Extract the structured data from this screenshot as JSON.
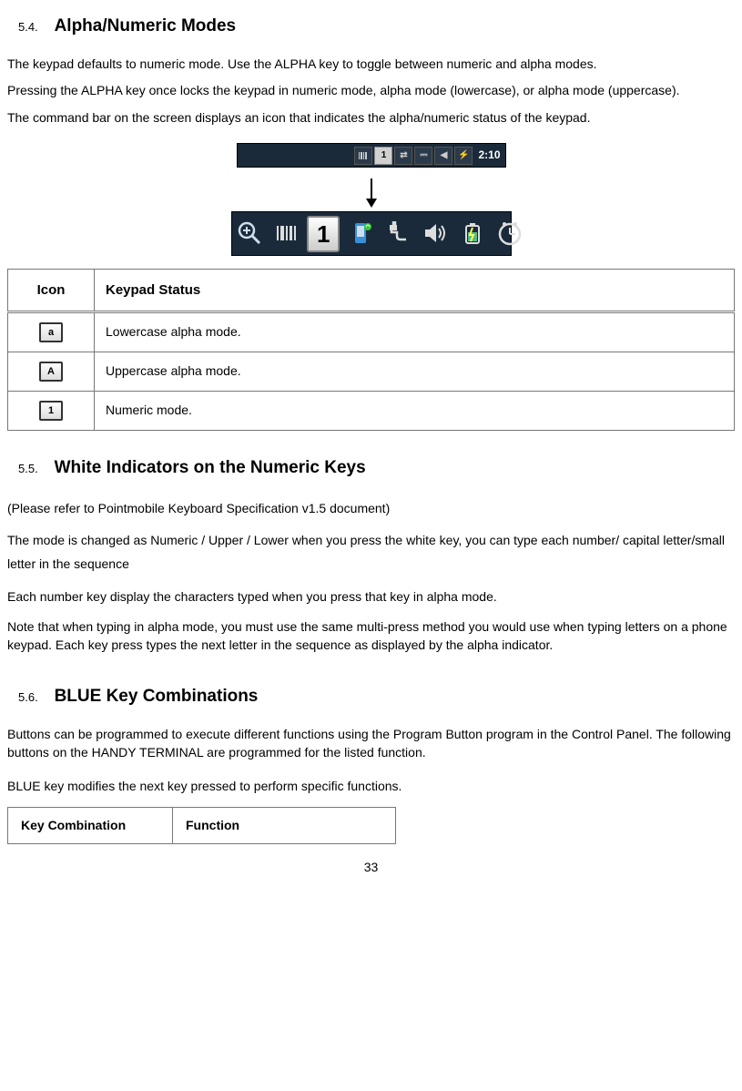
{
  "sections": {
    "s54": {
      "num": "5.4.",
      "title": "Alpha/Numeric Modes"
    },
    "s55": {
      "num": "5.5.",
      "title": "White Indicators on the Numeric Keys"
    },
    "s56": {
      "num": "5.6.",
      "title": "BLUE Key Combinations"
    }
  },
  "p1": "The keypad defaults to numeric mode. Use the ALPHA key to toggle between numeric and alpha modes.",
  "p2": "Pressing the ALPHA key once locks the keypad in numeric mode, alpha mode (lowercase), or alpha mode (uppercase).",
  "p3": "The command bar on the screen displays an icon that indicates the alpha/numeric status of the keypad.",
  "taskbar": {
    "mode_icon": "1",
    "time": "2:10"
  },
  "table1": {
    "headers": {
      "icon": "Icon",
      "status": "Keypad Status"
    },
    "rows": [
      {
        "icon": "a",
        "status": "Lowercase alpha mode."
      },
      {
        "icon": "A",
        "status": "Uppercase alpha mode."
      },
      {
        "icon": "1",
        "status": "Numeric mode."
      }
    ]
  },
  "p4": "(Please refer to Pointmobile Keyboard Specification v1.5 document)",
  "p5": "The mode is changed as Numeric / Upper / Lower when you press the white key, you can type each number/ capital letter/small letter in the sequence",
  "p6": "Each number key display the characters typed when you press that key in alpha mode.",
  "p7": "Note that when typing in alpha mode, you must use the same multi-press method you would use when typing letters on a phone keypad. Each key press types the next letter in the sequence as displayed by the alpha indicator.",
  "p8": "Buttons can be programmed to execute different functions using the Program Button program in the Control Panel. The following buttons on the HANDY TERMINAL are programmed for the listed function.",
  "p9": "BLUE key modifies the next key pressed to perform specific functions.",
  "table2": {
    "headers": {
      "combo": "Key Combination",
      "func": "Function"
    }
  },
  "page_number": "33"
}
